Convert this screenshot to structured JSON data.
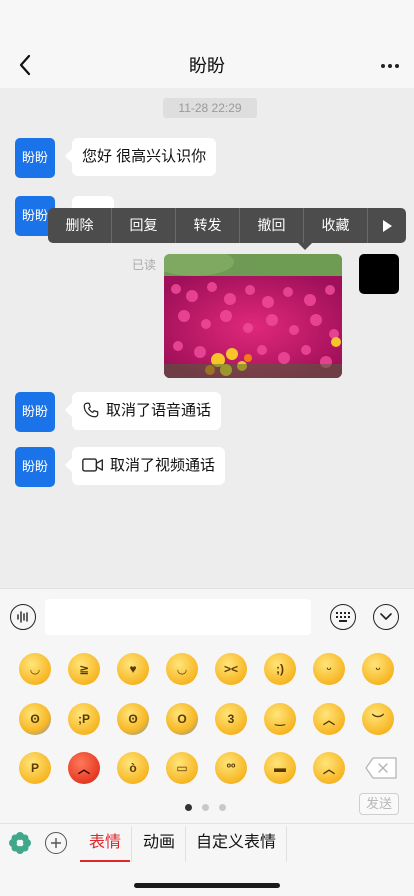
{
  "header": {
    "title": "盼盼",
    "back_icon": "chevron-left-icon",
    "more_icon": "more-dots-icon"
  },
  "chat": {
    "timestamp": "11-28 22:29",
    "contact_avatar_label": "盼盼",
    "messages": [
      {
        "side": "left",
        "type": "text",
        "text": "您好 很高兴认识你"
      },
      {
        "side": "left",
        "type": "sticker",
        "text": ""
      },
      {
        "side": "right",
        "type": "image",
        "read_status": "已读",
        "description_visible": false
      },
      {
        "side": "left",
        "type": "call",
        "icon": "phone-icon",
        "text": "取消了语音通话"
      },
      {
        "side": "left",
        "type": "call",
        "icon": "video-icon",
        "text": "取消了视频通话"
      }
    ]
  },
  "context_menu": {
    "items": [
      "删除",
      "回复",
      "转发",
      "撤回",
      "收藏"
    ],
    "more_icon": "play-right-icon"
  },
  "input_bar": {
    "voice_icon": "voice-wave-icon",
    "placeholder": "",
    "keyboard_icon": "keyboard-icon",
    "collapse_icon": "chevron-down-circle-icon"
  },
  "emoji_panel": {
    "rows": [
      [
        "grin",
        "tears-of-joy",
        "heart-eyes",
        "sweat-smile",
        "laughing",
        "wink",
        "yum",
        "blush"
      ],
      [
        "fearful",
        "tongue-wink",
        "cold-sweat",
        "scream",
        "kissing-heart",
        "smirk",
        "angry",
        "downcast-sweat"
      ],
      [
        "tongue-squint",
        "rage",
        "triumph",
        "mask",
        "flushed",
        "sunglasses",
        "sob"
      ]
    ],
    "delete_icon": "backspace-icon",
    "send_label": "发送",
    "page_count": 3,
    "active_page": 1
  },
  "tab_bar": {
    "settings_icon": "flower-settings-icon",
    "add_icon": "plus-circle-icon",
    "tabs": [
      {
        "label": "表情",
        "active": true
      },
      {
        "label": "动画",
        "active": false
      },
      {
        "label": "自定义表情",
        "active": false
      }
    ]
  },
  "colors": {
    "avatar_blue": "#1a73e8",
    "accent_red": "#e0252b",
    "menu_bg": "#4c4c4c",
    "chat_bg": "#ededed"
  }
}
